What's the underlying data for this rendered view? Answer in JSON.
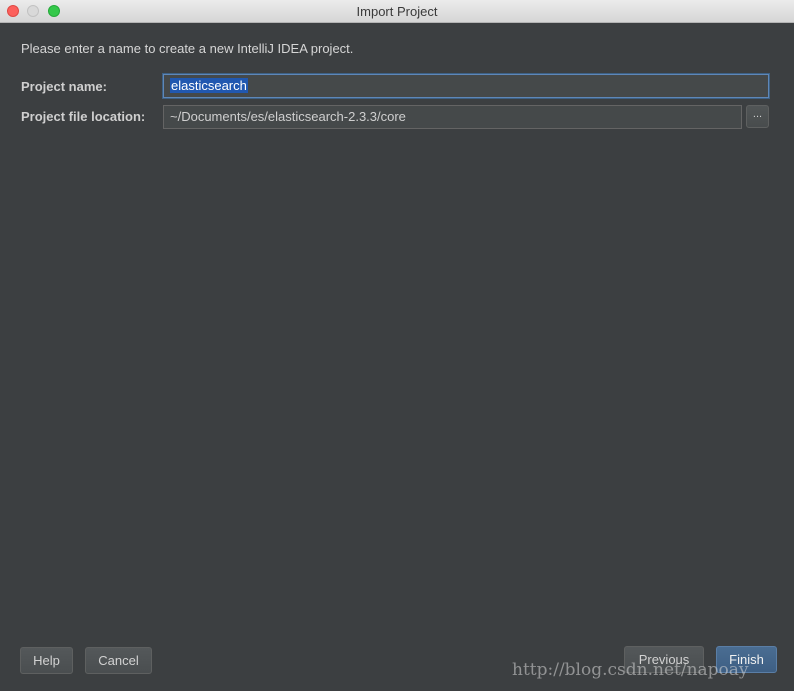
{
  "window": {
    "title": "Import Project"
  },
  "intro_text": "Please enter a name to create a new IntelliJ IDEA project.",
  "form": {
    "project_name_label": "Project name:",
    "project_name_value": "elasticsearch",
    "location_label": "Project file location:",
    "location_value": "~/Documents/es/elasticsearch-2.3.3/core",
    "browse_label": "..."
  },
  "buttons": {
    "help": "Help",
    "cancel": "Cancel",
    "previous": "Previous",
    "finish": "Finish"
  },
  "watermark": "http://blog.csdn.net/napoay",
  "colors": {
    "background": "#3c3f41",
    "selection": "#2158b0",
    "focus_border": "#5e87b8",
    "default_button": "#3e5f84"
  }
}
